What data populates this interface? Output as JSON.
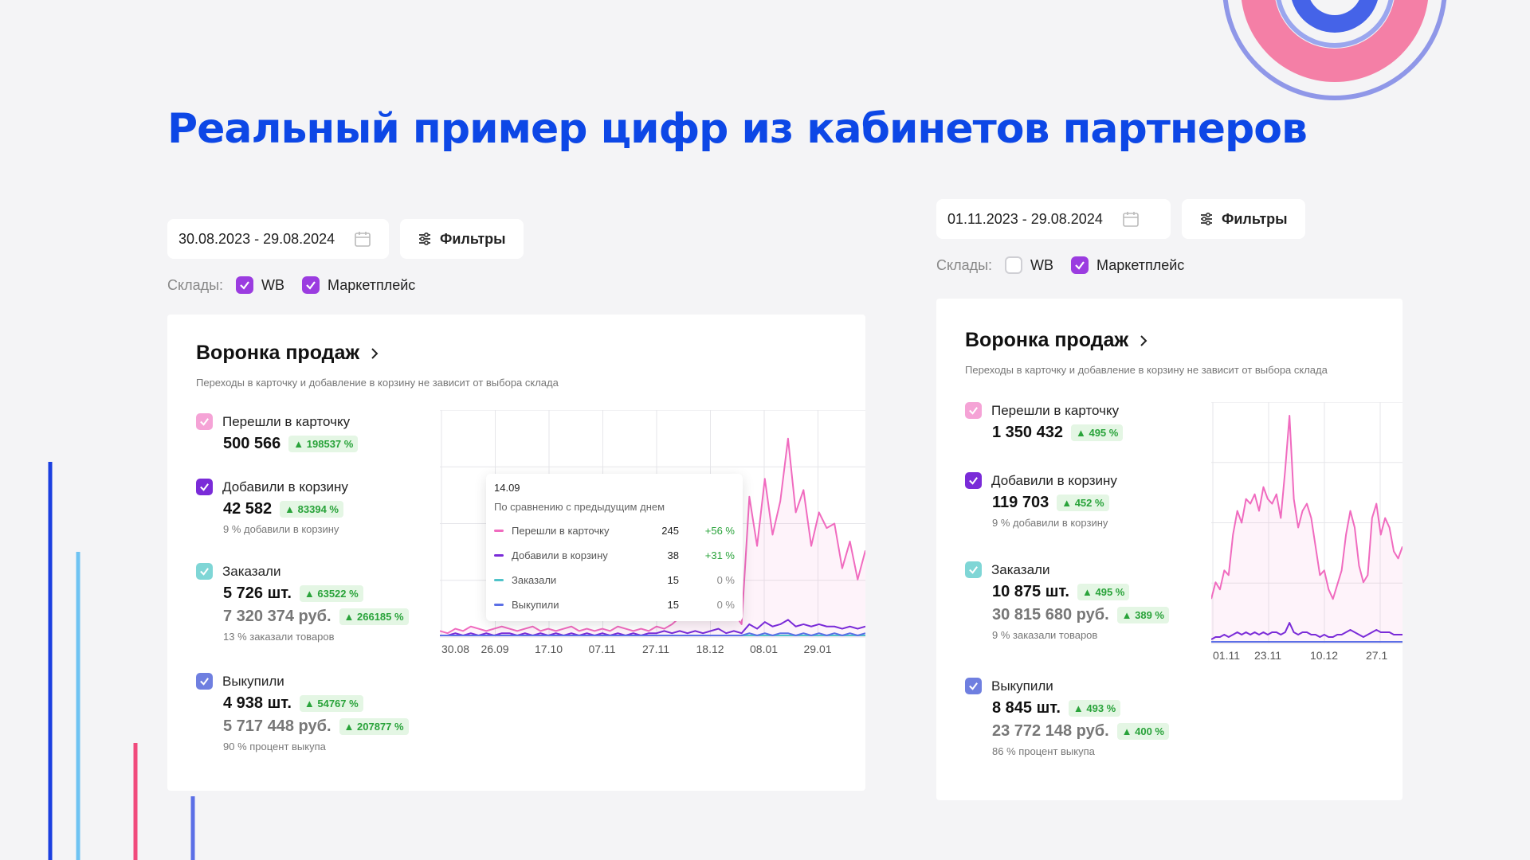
{
  "slide": {
    "title": "Реальный пример цифр из кабинетов партнеров",
    "colors": {
      "title": "#0d47e6",
      "pink": "#f06bbf",
      "purple": "#7a2bd8",
      "teal": "#4fc3c9",
      "blue": "#5b6fe6"
    }
  },
  "left": {
    "date_range": "30.08.2023 - 29.08.2024",
    "filter_label": "Фильтры",
    "warehouses_label": "Склады:",
    "warehouses": [
      {
        "name": "WB",
        "checked": true
      },
      {
        "name": "Маркетплейс",
        "checked": true
      }
    ],
    "card_title": "Воронка продаж",
    "card_subtitle": "Переходы в карточку и добавление в корзину не зависит от выбора склада",
    "metrics": {
      "visits": {
        "label": "Перешли в карточку",
        "value": "500 566",
        "delta": "198537 %"
      },
      "cart": {
        "label": "Добавили в корзину",
        "value": "42 582",
        "delta": "83394 %",
        "note": "9 % добавили в корзину"
      },
      "orders": {
        "label": "Заказали",
        "value": "5 726 шт.",
        "delta": "63522 %",
        "amount": "7 320 374 руб.",
        "amount_delta": "266185 %",
        "note": "13 % заказали товаров"
      },
      "bought": {
        "label": "Выкупили",
        "value": "4 938 шт.",
        "delta": "54767 %",
        "amount": "5 717 448 руб.",
        "amount_delta": "207877 %",
        "note": "90 % процент выкупа"
      }
    },
    "tooltip": {
      "date": "14.09",
      "subtitle": "По сравнению с предыдущим днем",
      "rows": [
        {
          "name": "Перешли в карточку",
          "value": "245",
          "pct": "+56 %"
        },
        {
          "name": "Добавили в корзину",
          "value": "38",
          "pct": "+31 %"
        },
        {
          "name": "Заказали",
          "value": "15",
          "pct": "0 %"
        },
        {
          "name": "Выкупили",
          "value": "15",
          "pct": "0 %"
        }
      ]
    }
  },
  "right": {
    "date_range": "01.11.2023 - 29.08.2024",
    "filter_label": "Фильтры",
    "warehouses_label": "Склады:",
    "warehouses": [
      {
        "name": "WB",
        "checked": false
      },
      {
        "name": "Маркетплейс",
        "checked": true
      }
    ],
    "card_title": "Воронка продаж",
    "card_subtitle": "Переходы в карточку и добавление в корзину не зависит от выбора склада",
    "metrics": {
      "visits": {
        "label": "Перешли в карточку",
        "value": "1 350 432",
        "delta": "495 %"
      },
      "cart": {
        "label": "Добавили в корзину",
        "value": "119 703",
        "delta": "452 %",
        "note": "9 % добавили в корзину"
      },
      "orders": {
        "label": "Заказали",
        "value": "10 875 шт.",
        "delta": "495 %",
        "amount": "30 815 680 руб.",
        "amount_delta": "389 %",
        "note": "9 % заказали товаров"
      },
      "bought": {
        "label": "Выкупили",
        "value": "8 845 шт.",
        "delta": "493 %",
        "amount": "23 772 148 руб.",
        "amount_delta": "400 %",
        "note": "86 % процент выкупа"
      }
    }
  },
  "chart_data": [
    {
      "type": "line",
      "x": [
        "30.08",
        "26.09",
        "17.10",
        "07.11",
        "27.11",
        "18.12",
        "08.01",
        "29.01"
      ],
      "series": [
        {
          "color": "#f06bbf",
          "values": [
            2,
            1,
            3,
            2,
            4,
            3,
            2,
            3,
            4,
            3,
            2,
            3,
            4,
            2,
            3,
            2,
            3,
            4,
            2,
            3,
            2,
            3,
            2,
            4,
            3,
            2,
            3,
            2,
            4,
            3,
            5,
            8,
            14,
            22,
            18,
            30,
            38,
            20,
            10,
            5,
            62,
            40,
            70,
            45,
            60,
            88,
            55,
            65,
            40,
            55,
            48,
            50,
            30,
            42,
            25,
            38
          ]
        },
        {
          "color": "#7a2bd8",
          "values": [
            0,
            0,
            1,
            0,
            1,
            0,
            1,
            0,
            1,
            1,
            0,
            1,
            0,
            1,
            0,
            1,
            0,
            1,
            0,
            1,
            0,
            1,
            0,
            1,
            0,
            1,
            0,
            1,
            1,
            2,
            1,
            2,
            1,
            2,
            1,
            2,
            3,
            1,
            2,
            1,
            5,
            3,
            6,
            4,
            5,
            7,
            4,
            5,
            4,
            5,
            4,
            4,
            3,
            4,
            3,
            4
          ]
        },
        {
          "color": "#4fc3c9",
          "values": [
            0,
            0,
            0,
            0,
            0,
            0,
            0,
            0,
            0,
            0,
            0,
            0,
            0,
            0,
            0,
            0,
            0,
            0,
            0,
            0,
            0,
            0,
            0,
            0,
            0,
            0,
            0,
            0,
            0,
            0,
            0,
            0,
            0,
            0,
            0,
            0,
            0,
            0,
            0,
            0,
            0,
            0,
            0,
            0,
            0,
            0,
            0,
            0,
            0,
            0,
            0,
            0,
            0,
            0,
            0,
            0
          ]
        },
        {
          "color": "#5b6fe6",
          "values": [
            0,
            0,
            0,
            0,
            0,
            0,
            0,
            0,
            0,
            0,
            0,
            0,
            0,
            0,
            0,
            0,
            0,
            0,
            0,
            0,
            0,
            0,
            0,
            0,
            0,
            0,
            0,
            0,
            0,
            0,
            0,
            0,
            0,
            0,
            0,
            0,
            0,
            0,
            0,
            0,
            1,
            0,
            1,
            0,
            1,
            1,
            0,
            1,
            0,
            1,
            0,
            1,
            0,
            1,
            0,
            1
          ]
        }
      ],
      "ylim": [
        0,
        100
      ],
      "grid": true
    },
    {
      "type": "line",
      "x": [
        "01.11",
        "23.11",
        "10.12",
        "27.1"
      ],
      "series": [
        {
          "color": "#f06bbf",
          "values": [
            18,
            25,
            22,
            30,
            28,
            45,
            55,
            50,
            60,
            58,
            62,
            55,
            65,
            60,
            58,
            62,
            52,
            72,
            95,
            60,
            48,
            55,
            58,
            52,
            40,
            28,
            30,
            22,
            18,
            24,
            30,
            45,
            55,
            48,
            32,
            25,
            28,
            52,
            58,
            45,
            52,
            48,
            38,
            35,
            40
          ]
        },
        {
          "color": "#7a2bd8",
          "values": [
            1,
            2,
            2,
            3,
            2,
            3,
            4,
            3,
            4,
            3,
            4,
            3,
            4,
            3,
            4,
            4,
            3,
            4,
            8,
            4,
            3,
            4,
            4,
            3,
            3,
            2,
            3,
            2,
            2,
            3,
            3,
            4,
            5,
            4,
            3,
            2,
            3,
            4,
            5,
            4,
            4,
            4,
            3,
            3,
            3
          ]
        },
        {
          "color": "#5b6fe6",
          "values": [
            0,
            0,
            0,
            0,
            0,
            0,
            0,
            0,
            0,
            0,
            0,
            0,
            0,
            0,
            0,
            0,
            0,
            0,
            0,
            0,
            0,
            0,
            0,
            0,
            0,
            0,
            0,
            0,
            0,
            0,
            0,
            0,
            0,
            0,
            0,
            0,
            0,
            0,
            0,
            0,
            0,
            0,
            0,
            0,
            0
          ]
        }
      ],
      "ylim": [
        0,
        100
      ],
      "grid": true
    }
  ]
}
